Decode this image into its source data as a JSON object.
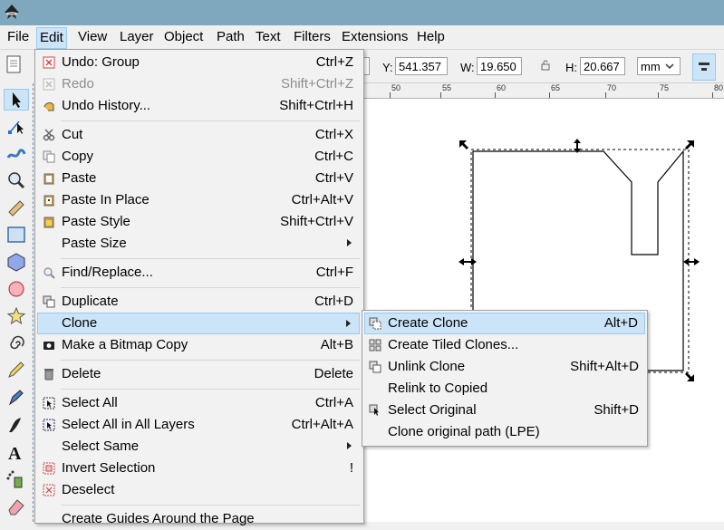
{
  "menubar": [
    {
      "key": "file",
      "label": "File"
    },
    {
      "key": "edit",
      "label": "Edit",
      "active": true
    },
    {
      "key": "view",
      "label": "View"
    },
    {
      "key": "layer",
      "label": "Layer"
    },
    {
      "key": "object",
      "label": "Object"
    },
    {
      "key": "path",
      "label": "Path"
    },
    {
      "key": "text",
      "label": "Text"
    },
    {
      "key": "filters",
      "label": "Filters"
    },
    {
      "key": "extensions",
      "label": "Extensions"
    },
    {
      "key": "help",
      "label": "Help"
    }
  ],
  "toolbar": {
    "y_label": "Y:",
    "y_value": "541.357",
    "w_label": "W:",
    "w_value": "19.650",
    "h_label": "H:",
    "h_value": "20.667",
    "unit": "mm"
  },
  "ruler": [
    "50",
    "55",
    "60",
    "65",
    "70",
    "75",
    "80"
  ],
  "edit_menu": {
    "items": [
      {
        "label": "Undo: Group",
        "accel": "Ctrl+Z",
        "icon": "undo-icon"
      },
      {
        "label": "Redo",
        "accel": "Shift+Ctrl+Z",
        "icon": "redo-icon",
        "disabled": true
      },
      {
        "label": "Undo History...",
        "accel": "Shift+Ctrl+H",
        "icon": "undo-history-icon"
      },
      {
        "label": "Cut",
        "accel": "Ctrl+X",
        "icon": "cut-icon"
      },
      {
        "label": "Copy",
        "accel": "Ctrl+C",
        "icon": "copy-icon"
      },
      {
        "label": "Paste",
        "accel": "Ctrl+V",
        "icon": "paste-icon"
      },
      {
        "label": "Paste In Place",
        "accel": "Ctrl+Alt+V",
        "icon": "paste-in-place-icon"
      },
      {
        "label": "Paste Style",
        "accel": "Shift+Ctrl+V",
        "icon": "paste-style-icon"
      },
      {
        "label": "Paste Size",
        "accel": "",
        "icon": ""
      },
      {
        "label": "Find/Replace...",
        "accel": "Ctrl+F",
        "icon": "find-icon"
      },
      {
        "label": "Duplicate",
        "accel": "Ctrl+D",
        "icon": "duplicate-icon"
      },
      {
        "label": "Clone",
        "accel": "",
        "icon": ""
      },
      {
        "label": "Make a Bitmap Copy",
        "accel": "Alt+B",
        "icon": "bitmap-copy-icon"
      },
      {
        "label": "Delete",
        "accel": "Delete",
        "icon": "delete-icon"
      },
      {
        "label": "Select All",
        "accel": "Ctrl+A",
        "icon": "select-all-icon"
      },
      {
        "label": "Select All in All Layers",
        "accel": "Ctrl+Alt+A",
        "icon": "select-all-layers-icon"
      },
      {
        "label": "Select Same",
        "accel": "",
        "icon": ""
      },
      {
        "label": "Invert Selection",
        "accel": "!",
        "icon": "invert-selection-icon"
      },
      {
        "label": "Deselect",
        "accel": "",
        "icon": "deselect-icon"
      },
      {
        "label": "Create Guides Around the Page",
        "accel": "",
        "icon": ""
      }
    ]
  },
  "clone_submenu": {
    "items": [
      {
        "label": "Create Clone",
        "accel": "Alt+D",
        "icon": "create-clone-icon"
      },
      {
        "label": "Create Tiled Clones...",
        "accel": "",
        "icon": "tiled-clones-icon"
      },
      {
        "label": "Unlink Clone",
        "accel": "Shift+Alt+D",
        "icon": "unlink-clone-icon"
      },
      {
        "label": "Relink to Copied",
        "accel": "",
        "icon": ""
      },
      {
        "label": "Select Original",
        "accel": "Shift+D",
        "icon": "select-original-icon"
      },
      {
        "label": "Clone original path (LPE)",
        "accel": "",
        "icon": ""
      }
    ]
  },
  "colors": {
    "titlebar": "#7fa7bd",
    "highlight": "#cce4f7",
    "highlight_border": "#99c9ef"
  }
}
